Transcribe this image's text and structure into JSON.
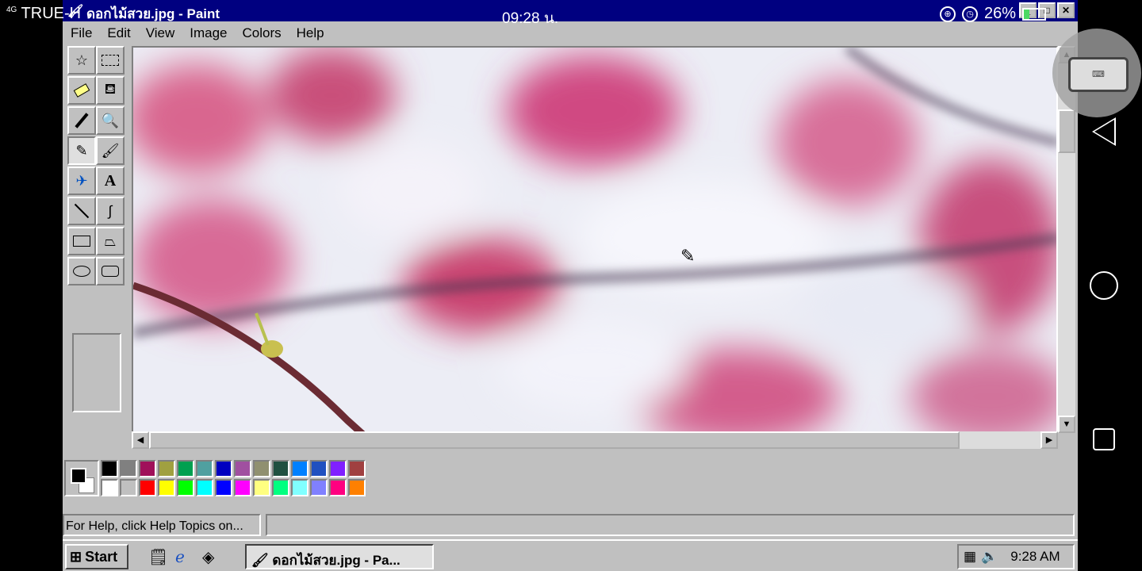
{
  "phone_status": {
    "signal": "4G",
    "carrier": "TRUE-H",
    "clock": "09:28 น.",
    "battery": "26%"
  },
  "window": {
    "title": "ดอกไม้สวย.jpg - Paint",
    "controls": [
      "minimize",
      "maximize",
      "close"
    ]
  },
  "menubar": {
    "items": [
      "File",
      "Edit",
      "View",
      "Image",
      "Colors",
      "Help"
    ]
  },
  "toolbox": {
    "tools": [
      {
        "name": "free-form-select",
        "icon": "star-select-icon"
      },
      {
        "name": "select",
        "icon": "rect-select-icon"
      },
      {
        "name": "eraser",
        "icon": "eraser-icon"
      },
      {
        "name": "fill-with-color",
        "icon": "paint-bucket-icon"
      },
      {
        "name": "pick-color",
        "icon": "eyedropper-icon"
      },
      {
        "name": "magnifier",
        "icon": "magnifier-icon"
      },
      {
        "name": "pencil",
        "icon": "pencil-icon",
        "active": true
      },
      {
        "name": "brush",
        "icon": "brush-icon"
      },
      {
        "name": "airbrush",
        "icon": "airbrush-icon"
      },
      {
        "name": "text",
        "icon": "text-icon",
        "glyph": "A"
      },
      {
        "name": "line",
        "icon": "line-icon"
      },
      {
        "name": "curve",
        "icon": "curve-icon"
      },
      {
        "name": "rectangle",
        "icon": "rectangle-icon"
      },
      {
        "name": "polygon",
        "icon": "polygon-icon"
      },
      {
        "name": "ellipse",
        "icon": "ellipse-icon"
      },
      {
        "name": "rounded-rectangle",
        "icon": "rounded-rectangle-icon"
      }
    ]
  },
  "palette": {
    "foreground": "#000000",
    "background": "#ffffff",
    "top_row": [
      "#000000",
      "#808080",
      "#a0105a",
      "#a0a040",
      "#00a050",
      "#50a0a0",
      "#0000c0",
      "#a050a0",
      "#909070",
      "#205040",
      "#0080ff",
      "#2050c0",
      "#8020ff",
      "#a04040"
    ],
    "bottom_row": [
      "#ffffff",
      "#c0c0c0",
      "#ff0000",
      "#ffff00",
      "#00ff00",
      "#00ffff",
      "#0000ff",
      "#ff00ff",
      "#ffff80",
      "#00ff80",
      "#80ffff",
      "#8080ff",
      "#ff0080",
      "#ff8000"
    ]
  },
  "statusbar": {
    "message": "For Help, click Help Topics on..."
  },
  "taskbar": {
    "start_label": "Start",
    "quick_launch": [
      "show-desktop-icon",
      "internet-explorer-icon",
      "channels-icon"
    ],
    "task_label": "ดอกไม้สวย.jpg - Pa...",
    "time": "9:28 AM"
  }
}
